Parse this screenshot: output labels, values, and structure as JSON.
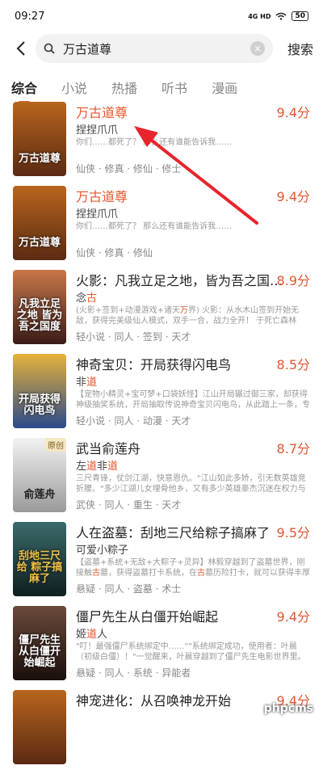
{
  "status": {
    "time": "09:27",
    "network": "4G HD",
    "battery": "50"
  },
  "search": {
    "query": "万古道尊",
    "button_label": "搜索"
  },
  "tabs": [
    "综合",
    "小说",
    "热播",
    "听书",
    "漫画"
  ],
  "results": [
    {
      "title": "万古道尊",
      "score": "9.4分",
      "author": "捏捏爪爪",
      "desc": "你们……都死了？ 那么还有谁能告诉我……",
      "tags": "仙侠 · 修真 · 修仙 · 修士",
      "cover_text": "万古道尊",
      "cover_bg": "#5a2a12"
    },
    {
      "title": "万古道尊",
      "score": "9.4分",
      "author": "捏捏爪爪",
      "desc": "你们……都死了？ 那么还有谁能告诉我……",
      "tags": "仙侠 · 修真 · 修仙",
      "cover_text": "万古道尊",
      "cover_bg": "#5a2a12"
    },
    {
      "title": "火影：凡我立足之地，皆为吾之国…",
      "score": "8.9分",
      "author_a": "念",
      "author_b": "古",
      "desc_a": "(火影+签到+动漫游戏+诸天",
      "desc_b": "万",
      "desc_c": "界)    火影：从水木山签到开始无敌，获得完美级仙人模式，双手一合，战力全开！    于死亡森林签…",
      "tags": "轻小说 · 同人 · 签到 · 天才",
      "cover_text": "凡我立足之地 皆为吾之国度",
      "cover_bg": "#7a3b2a"
    },
    {
      "title": "神奇宝贝：开局获得闪电鸟",
      "score": "8.5分",
      "author_a": "非",
      "author_b": "道",
      "desc": "【宠物小精灵+宝可梦+口袋妖怪】江山开局辗过御三家，却获得神级抽奖系统，开局抽取传说神奇宝贝闪电鸟，从此踏上一条，专门…",
      "tags": "轻小说 · 同人 · 动漫 · 天才",
      "cover_text": "开局获得 闪电鸟",
      "cover_bg": "#2a4a8a"
    },
    {
      "title": "武当俞莲舟",
      "score": "8.7分",
      "author_a": "左",
      "author_b": "道",
      "author_c": "非",
      "author_d": "道",
      "desc": "三尺青锋，仗剑江湖，快意恩仇。\"江山如此多娇，引无数英雄竞折腰。\"多少江湖儿女埋骨他乡，又有多少英雄豪杰沉迷在权力与欲…",
      "tags": "武侠 · 同人 · 重生 · 天才",
      "cover_text": "俞莲舟",
      "cover_bg": "#d9d9d9",
      "badge": "原创"
    },
    {
      "title": "人在盗墓：刮地三尺给粽子搞麻了",
      "score": "9.5分",
      "author": "可爱小粽子",
      "desc_a": "【盗墓+系统+无敌+大粽子+灵异】林毅穿越到了盗墓世界，刚接触",
      "desc_b": "古",
      "desc_c": "墓，获得盗墓打卡系统，在",
      "desc_d": "古",
      "desc_e": "墓历险打卡，就可以获得丰厚奖励。绝世武学龙…",
      "tags": "悬疑 · 同人 · 盗墓 · 术士",
      "cover_text": "刮地三尺给 粽子搞麻了",
      "cover_bg": "#1f3a3a"
    },
    {
      "title": "僵尸先生从白僵开始崛起",
      "score": "9.4分",
      "author_a": "姬",
      "author_b": "道",
      "author_c": "人",
      "desc": "\"叮！最强僵尸系统绑定中……\"\"系统绑定成功，使用者：叶晨（初级白僵）！\"一觉醒来，叶晨穿越到了僵尸先生电影世界里。身为…",
      "tags": "悬疑 · 同人 · 系统 · 异能者",
      "cover_text": "僵尸先生 从白僵开始崛起",
      "cover_bg": "#2b1a14"
    },
    {
      "title": "神宠进化：从召唤神龙开始",
      "score": "9.4分",
      "author": "",
      "desc": "",
      "tags": "",
      "cover_text": "",
      "cover_bg": "#5a2a12"
    }
  ],
  "watermark": "phpcms",
  "colors": {
    "accent": "#e4572e",
    "arrow": "#e8242c"
  }
}
